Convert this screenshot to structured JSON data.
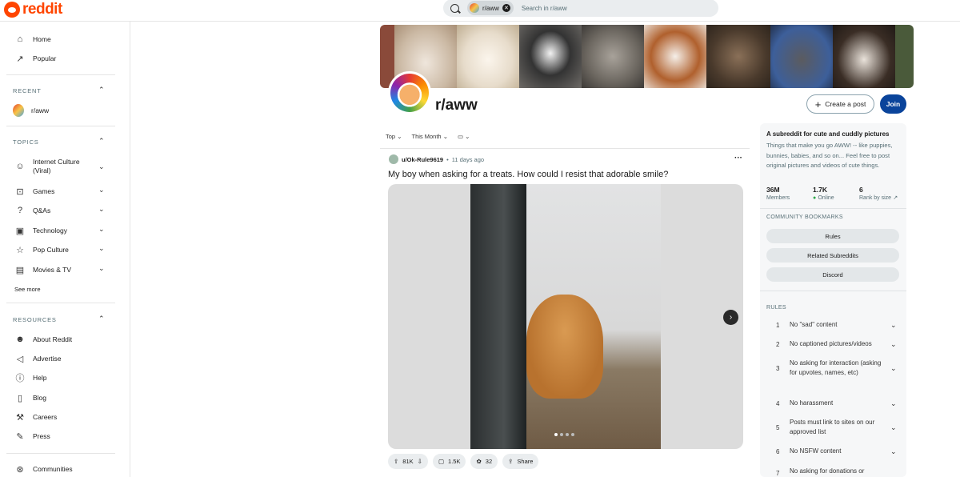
{
  "header": {
    "logo_text": "reddit",
    "search_chip": "r/aww",
    "search_placeholder": "Search in r/aww"
  },
  "sidebar": {
    "home": "Home",
    "popular": "Popular",
    "recent_head": "RECENT",
    "recent_item": "r/aww",
    "topics_head": "TOPICS",
    "topics": [
      {
        "label": "Internet Culture\n(Viral)",
        "icon": "smile-icon"
      },
      {
        "label": "Games",
        "icon": "gamepad-icon"
      },
      {
        "label": "Q&As",
        "icon": "question-icon"
      },
      {
        "label": "Technology",
        "icon": "chip-icon"
      },
      {
        "label": "Pop Culture",
        "icon": "star-icon"
      },
      {
        "label": "Movies & TV",
        "icon": "clapper-icon"
      }
    ],
    "see_more": "See more",
    "resources_head": "RESOURCES",
    "resources": [
      {
        "label": "About Reddit",
        "icon": "reddit-icon"
      },
      {
        "label": "Advertise",
        "icon": "megaphone-icon"
      },
      {
        "label": "Help",
        "icon": "help-icon"
      },
      {
        "label": "Blog",
        "icon": "book-icon"
      },
      {
        "label": "Careers",
        "icon": "wrench-icon"
      },
      {
        "label": "Press",
        "icon": "pen-icon"
      }
    ],
    "communities": "Communities"
  },
  "community": {
    "name": "r/aww",
    "create_post": "Create a post",
    "join": "Join"
  },
  "sort": {
    "top": "Top",
    "time": "This Month"
  },
  "post": {
    "user": "u/Ok-Rule9619",
    "time": "11 days ago",
    "title": "My boy when asking for a treats. How could I resist that adorable smile?",
    "upvotes": "81K",
    "comments": "1.5K",
    "awards": "32",
    "share": "Share"
  },
  "about": {
    "title": "A subreddit for cute and cuddly pictures",
    "desc": "Things that make you go AWW! -- like puppies, bunnies, babies, and so on... Feel free to post original pictures and videos of cute things.",
    "members_val": "36M",
    "members_label": "Members",
    "online_val": "1.7K",
    "online_label": "Online",
    "rank_val": "6",
    "rank_label": "Rank by size",
    "bookmarks_head": "COMMUNITY BOOKMARKS",
    "bookmarks": [
      "Rules",
      "Related Subreddits",
      "Discord"
    ],
    "rules_head": "RULES",
    "rules": [
      {
        "n": "1",
        "t": "No \"sad\" content"
      },
      {
        "n": "2",
        "t": "No captioned pictures/videos"
      },
      {
        "n": "3",
        "t": "No asking for interaction (asking for upvotes, names, etc)"
      },
      {
        "n": "4",
        "t": "No harassment"
      },
      {
        "n": "5",
        "t": "Posts must link to sites on our approved list"
      },
      {
        "n": "6",
        "t": "No NSFW content"
      },
      {
        "n": "7",
        "t": "No asking for donations or"
      }
    ]
  },
  "colors": {
    "brand": "#ff4500",
    "join": "#0a449b",
    "online": "#2ea84a"
  }
}
